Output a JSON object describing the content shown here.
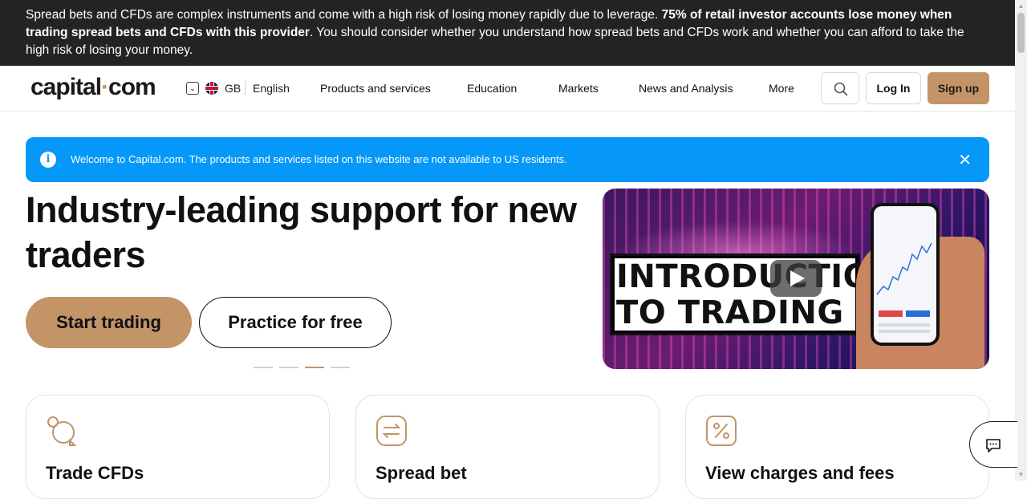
{
  "risk_warning": {
    "text_before": "Spread bets and CFDs are complex instruments and come with a high risk of losing money rapidly due to leverage. ",
    "text_bold": "75% of retail investor accounts lose money when trading spread bets and CFDs with this provider",
    "text_after": ". You should consider whether you understand how spread bets and CFDs work and whether you can afford to take the high risk of losing your money."
  },
  "header": {
    "logo_prefix": "capital",
    "logo_dot": "·",
    "logo_suffix": "com",
    "region_code": "GB",
    "language": "English",
    "nav": [
      "Products and services",
      "Education",
      "Markets",
      "News and Analysis",
      "More"
    ],
    "login_label": "Log In",
    "signup_label": "Sign up"
  },
  "banner": {
    "info_icon": "i",
    "text": "Welcome to Capital.com. The products and services listed on this website are not available to US residents.",
    "close_icon": "✕"
  },
  "hero": {
    "title": "Industry-leading support for new traders",
    "start_label": "Start trading",
    "practice_label": "Practice for free",
    "slides_count": 4,
    "active_slide": 3,
    "video_line1": "INTRODUCTION",
    "video_line2": "TO TRADING"
  },
  "cards": [
    {
      "title": "Trade CFDs",
      "icon": "coins-icon"
    },
    {
      "title": "Spread bet",
      "icon": "swap-arrows-icon"
    },
    {
      "title": "View charges and fees",
      "icon": "percent-icon"
    }
  ],
  "colors": {
    "accent": "#c39466",
    "banner_blue": "#0598f8",
    "risk_bar": "#232323"
  }
}
